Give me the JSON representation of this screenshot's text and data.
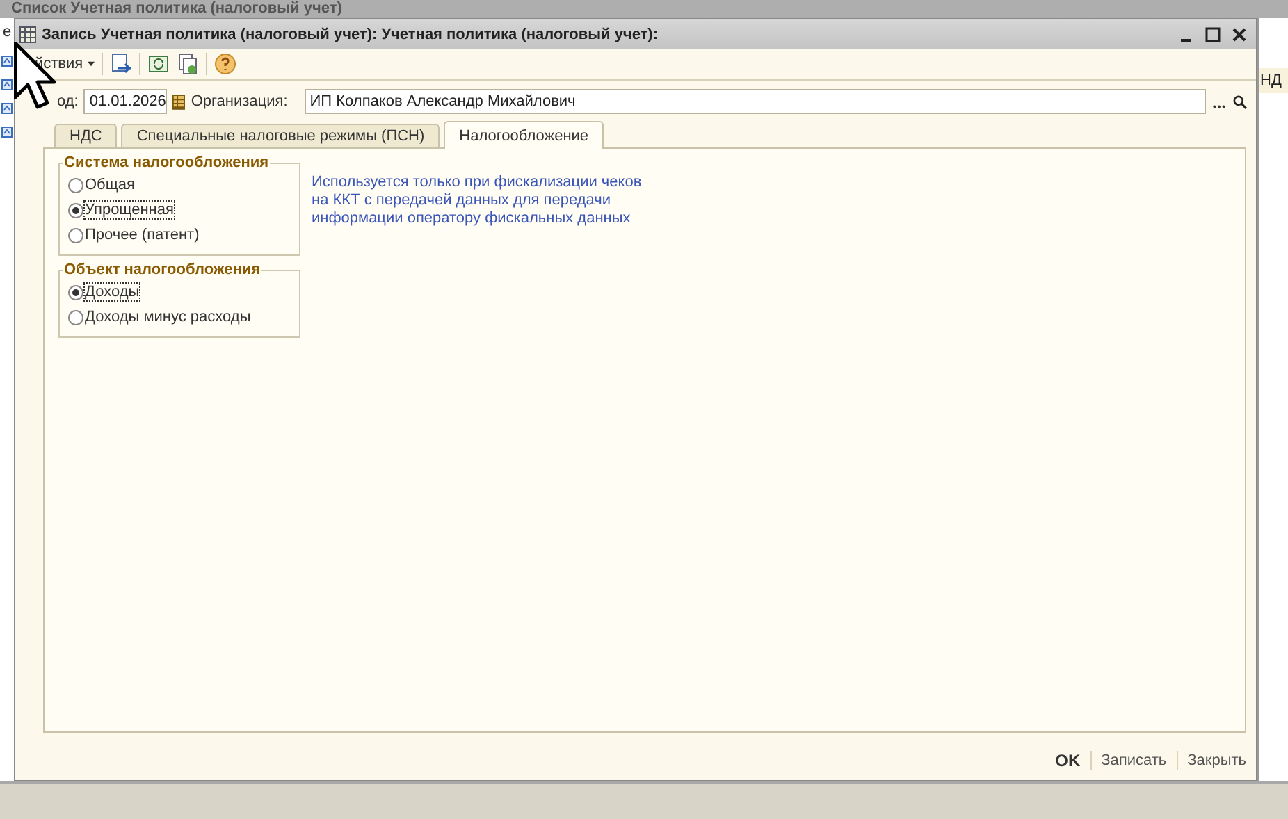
{
  "background_window": {
    "title": "Список Учетная политика (налоговый учет)",
    "left_text": "е",
    "column_header": "НД"
  },
  "window": {
    "title": "Запись Учетная политика (налоговый учет): Учетная политика (налоговый учет):"
  },
  "toolbar": {
    "actions_menu": "йствия"
  },
  "form": {
    "date_label": "од:",
    "date": "01.01.2026",
    "org_label": "Организация:",
    "org": "ИП Колпаков Александр Михайлович"
  },
  "tabs": [
    {
      "label": "НДС",
      "selected": false
    },
    {
      "label": "Специальные налоговые режимы (ПСН)",
      "selected": false
    },
    {
      "label": "Налогообложение",
      "selected": true
    }
  ],
  "groups": [
    {
      "title": "Система налогообложения",
      "options": [
        {
          "label": "Общая",
          "selected": false
        },
        {
          "label": "Упрощенная",
          "selected": true
        },
        {
          "label": "Прочее (патент)",
          "selected": false
        }
      ]
    },
    {
      "title": "Объект налогообложения",
      "options": [
        {
          "label": "Доходы",
          "selected": true
        },
        {
          "label": "Доходы минус расходы",
          "selected": false
        }
      ]
    }
  ],
  "note": "Используется только при фискализации чеков\nна ККТ с передачей данных для передачи\nинформации оператору фискальных данных",
  "buttons": [
    {
      "label": "OK",
      "kind": "default"
    },
    {
      "label": "Записать",
      "kind": "plain"
    },
    {
      "label": "Закрыть",
      "kind": "plain"
    }
  ]
}
